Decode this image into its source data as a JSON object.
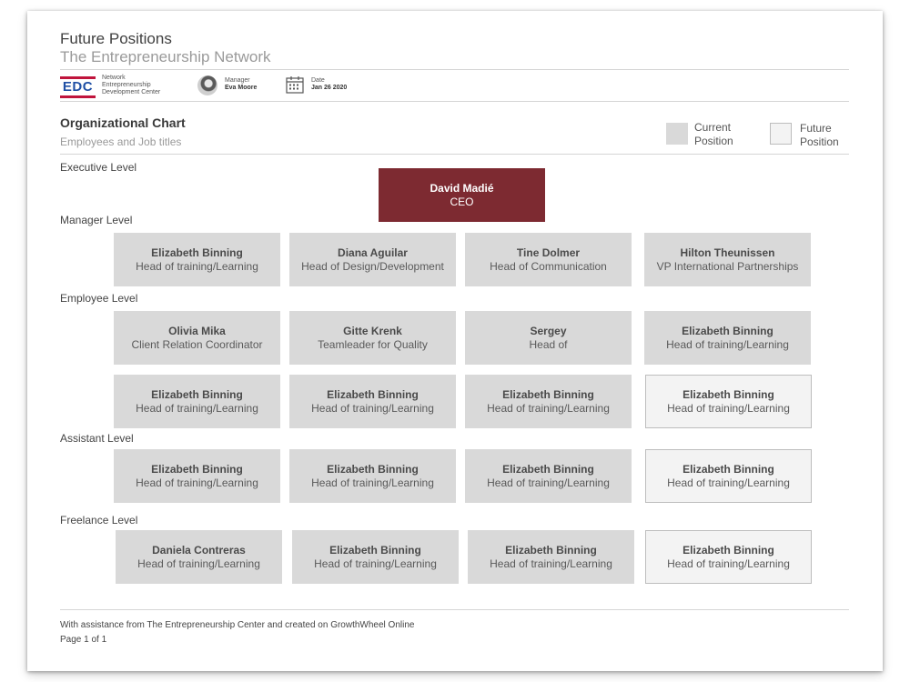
{
  "header": {
    "title": "Future Positions",
    "subtitle": "The Entrepreneurship Network"
  },
  "meta": {
    "logo_text": "EDC",
    "network_label": "Network",
    "network_line1": "Entrepreneurship",
    "network_line2": "Development Center",
    "manager_label": "Manager",
    "manager_name": "Eva Moore",
    "date_label": "Date",
    "date_value": "Jan 26 2020"
  },
  "section": {
    "title": "Organizational Chart",
    "subtitle": "Employees and Job titles"
  },
  "legend": {
    "current_line1": "Current",
    "current_line2": "Position",
    "future_line1": "Future",
    "future_line2": "Position"
  },
  "levels": {
    "executive": "Executive Level",
    "manager": "Manager Level",
    "employee": "Employee Level",
    "assistant": "Assistant Level",
    "freelance": "Freelance Level"
  },
  "ceo": {
    "name": "David Madié",
    "role": "CEO"
  },
  "manager_cards": [
    {
      "name": "Elizabeth Binning",
      "role": "Head of training/Learning"
    },
    {
      "name": "Diana Aguilar",
      "role": "Head of Design/Development"
    },
    {
      "name": "Tine Dolmer",
      "role": "Head of Communication"
    },
    {
      "name": "Hilton Theunissen",
      "role": "VP International Partnerships"
    }
  ],
  "employee_cards_row1": [
    {
      "name": "Olivia Mika",
      "role": "Client Relation Coordinator"
    },
    {
      "name": "Gitte Krenk",
      "role": "Teamleader for Quality"
    },
    {
      "name": "Sergey",
      "role": "Head of"
    },
    {
      "name": "Elizabeth Binning",
      "role": "Head of training/Learning"
    }
  ],
  "employee_cards_row2": [
    {
      "name": "Elizabeth Binning",
      "role": "Head of training/Learning"
    },
    {
      "name": "Elizabeth Binning",
      "role": "Head of training/Learning"
    },
    {
      "name": "Elizabeth Binning",
      "role": "Head of training/Learning"
    },
    {
      "name": "Elizabeth Binning",
      "role": "Head of training/Learning"
    }
  ],
  "assistant_cards": [
    {
      "name": "Elizabeth Binning",
      "role": "Head of training/Learning"
    },
    {
      "name": "Elizabeth Binning",
      "role": "Head of training/Learning"
    },
    {
      "name": "Elizabeth Binning",
      "role": "Head of training/Learning"
    },
    {
      "name": "Elizabeth Binning",
      "role": "Head of training/Learning"
    }
  ],
  "freelance_cards": [
    {
      "name": "Daniela Contreras",
      "role": "Head of training/Learning"
    },
    {
      "name": "Elizabeth Binning",
      "role": "Head of training/Learning"
    },
    {
      "name": "Elizabeth Binning",
      "role": "Head of training/Learning"
    },
    {
      "name": "Elizabeth Binning",
      "role": "Head of training/Learning"
    }
  ],
  "footer": {
    "credit": "With assistance from The Entrepreneurship Center and created  on GrowthWheel Online",
    "page": "Page 1 of 1"
  },
  "colors": {
    "ceo_fill": "#7d2a31",
    "current_fill": "#d9d9d9",
    "future_fill": "#f3f3f3",
    "logo_blue": "#1f4fa5",
    "logo_red": "#c0143c"
  }
}
